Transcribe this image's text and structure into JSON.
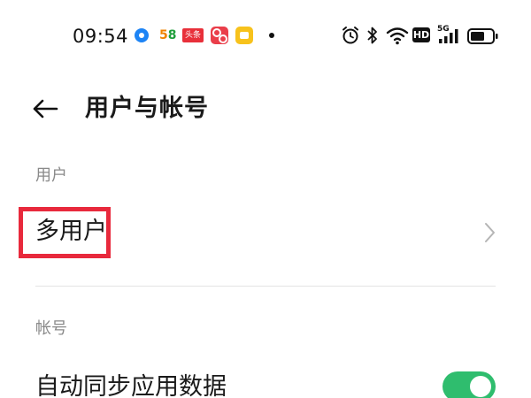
{
  "status_bar": {
    "time": "09:54",
    "notifications": [
      {
        "icon": "app-blue-circle-icon"
      },
      {
        "icon": "app-58-icon",
        "text": "58"
      },
      {
        "icon": "app-toutiao-icon",
        "text": "头条"
      },
      {
        "icon": "app-red-icon"
      },
      {
        "icon": "app-yellow-icon"
      },
      {
        "icon": "more-notifications-dot-icon"
      }
    ],
    "system_icons": [
      "alarm-icon",
      "bluetooth-icon",
      "wifi-icon",
      "hd-icon",
      "5g-signal-icon",
      "battery-icon"
    ],
    "hd_label": "HD",
    "network_label": "5G",
    "battery_level": 0.65
  },
  "header": {
    "back_icon": "back-arrow-icon",
    "title": "用户与帐号"
  },
  "sections": {
    "users": {
      "header": "用户",
      "items": [
        {
          "label": "多用户",
          "icon": "chevron-right-icon",
          "highlighted": true
        }
      ]
    },
    "accounts": {
      "header": "帐号",
      "items": [
        {
          "label": "自动同步应用数据",
          "toggle_on": true
        }
      ]
    }
  },
  "colors": {
    "toggle_on": "#2fbd6e",
    "highlight_box": "#e8293c",
    "section_header": "#8a8a8a"
  }
}
